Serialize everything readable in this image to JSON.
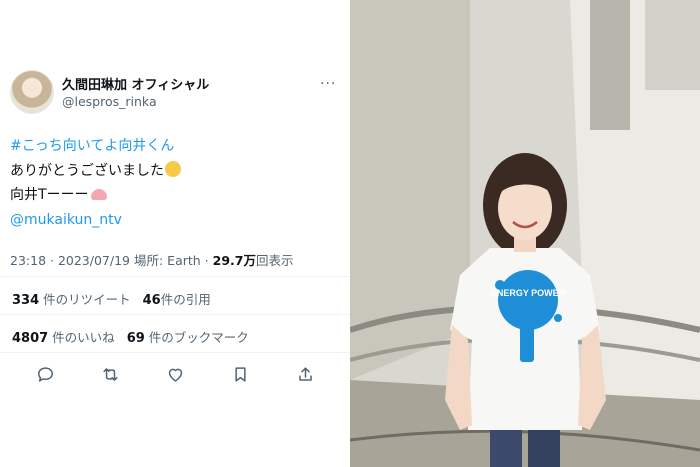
{
  "tweet": {
    "display_name": "久間田琳加 オフィシャル",
    "handle": "@lespros_rinka",
    "more": "···",
    "lines": {
      "hashtag": "#こっち向いてよ向井くん",
      "thanks": "ありがとうございました",
      "shirt": "向井Tーーー",
      "mention": "@mukaikun_ntv"
    },
    "emojis": [
      "relieved-face-icon",
      "heart-hands-icon"
    ],
    "meta": {
      "time": "23:18",
      "separator": " · ",
      "date": "2023/07/19",
      "location": "場所: Earth",
      "views_value": "29.7万",
      "views_label": "回表示"
    },
    "stats": {
      "retweets_value": "334",
      "retweets_label": "件のリツイート",
      "quotes_value": "46",
      "quotes_label": "件の引用",
      "likes_value": "4807",
      "likes_label": "件のいいね",
      "bookmarks_value": "69",
      "bookmarks_label": "件のブックマーク"
    },
    "actions": [
      "reply-icon",
      "retweet-icon",
      "like-icon",
      "bookmark-icon",
      "share-icon"
    ]
  },
  "photo": {
    "shirt_print": "ENERGY POWER"
  },
  "colors": {
    "link": "#1d9bf0",
    "secondary_text": "#536471",
    "primary_text": "#0f1419",
    "shirt_print": "#1e8fd6"
  }
}
